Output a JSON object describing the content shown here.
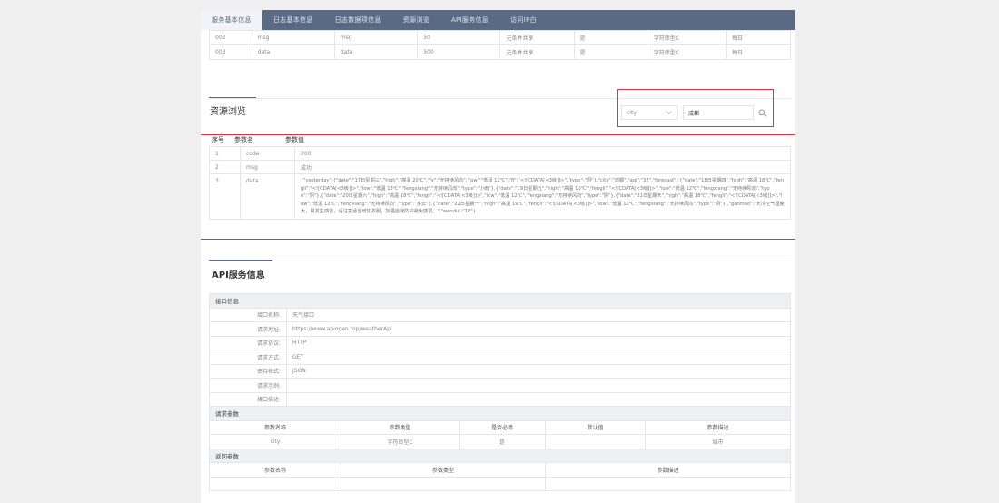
{
  "tabs": [
    "服务基本信息",
    "日志基本信息",
    "日志数据项信息",
    "资源浏览",
    "API服务信息",
    "访问IP白"
  ],
  "top_rows": [
    [
      "002",
      "msg",
      "msg",
      "50",
      "无条件共享",
      "是",
      "字符串型C",
      "每日"
    ],
    [
      "003",
      "data",
      "data",
      "500",
      "无条件共享",
      "是",
      "字符串型C",
      "每日"
    ]
  ],
  "resource": {
    "title": "资源浏览",
    "search_field": "city",
    "search_value": "成都",
    "headers": [
      "序号",
      "参数名",
      "参数值"
    ],
    "rows": [
      {
        "no": "1",
        "name": "code",
        "value": "200"
      },
      {
        "no": "2",
        "name": "msg",
        "value": "成功"
      },
      {
        "no": "3",
        "name": "data",
        "value": "{\"yesterday\":{\"date\":\"17日星期三\",\"high\":\"高温 20℃\",\"fx\":\"无持续风向\",\"low\":\"低温 12℃\",\"fl\":\"<![CDATA[<3级]]>\",\"type\":\"阴\"},\"city\":\"成都\",\"aqi\":\"35\",\"forecast\":[{\"date\":\"18日星期四\",\"high\":\"高温 18℃\",\"fengli\":\"<![CDATA[<3级]]>\",\"low\":\"低温 13℃\",\"fengxiang\":\"无持续风向\",\"type\":\"小雨\"},{\"date\":\"19日星期五\",\"high\":\"高温 16℃\",\"fengli\":\"<![CDATA[<3级]]>\",\"low\":\"低温 12℃\",\"fengxiang\":\"无持续风向\",\"type\":\"阴\"},{\"date\":\"20日星期六\",\"high\":\"高温 18℃\",\"fengli\":\"<![CDATA[<3级]]>\",\"low\":\"低温 12℃\",\"fengxiang\":\"无持续风向\",\"type\":\"阴\"},{\"date\":\"21日星期天\",\"high\":\"高温 18℃\",\"fengli\":\"<![CDATA[<3级]]>\",\"low\":\"低温 12℃\",\"fengxiang\":\"无持续风向\",\"type\":\"多云\"},{\"date\":\"22日星期一\",\"high\":\"高温 19℃\",\"fengli\":\"<![CDATA[<3级]]>\",\"low\":\"低温 12℃\",\"fengxiang\":\"无持续风向\",\"type\":\"阴\"}],\"ganmao\":\"天冷空气湿度大，易发生感冒，请注意适当增加衣服，加强自我防护避免感冒。\",\"wendu\":\"16\"}"
      }
    ]
  },
  "api": {
    "title": "API服务信息",
    "interface_group": "接口信息",
    "fields": [
      {
        "label": "接口名称:",
        "value": "天气接口"
      },
      {
        "label": "请求地址:",
        "value": "https://www.apiopen.top/weatherApi"
      },
      {
        "label": "请求协议:",
        "value": "HTTP"
      },
      {
        "label": "请求方式:",
        "value": "GET"
      },
      {
        "label": "支持格式:",
        "value": "JSON"
      },
      {
        "label": "请求示例:",
        "value": ""
      },
      {
        "label": "接口描述:",
        "value": ""
      }
    ],
    "request_group": "请求参数",
    "request_headers": [
      "参数名称",
      "参数类型",
      "是否必填",
      "默认值",
      "参数描述"
    ],
    "request_rows": [
      [
        "city",
        "字符串型C",
        "是",
        "",
        "城市"
      ]
    ],
    "response_group": "返回参数",
    "response_headers": [
      "参数名称",
      "参数类型",
      "参数描述"
    ]
  },
  "colors": {
    "tab_bar": "#5b6a84",
    "highlight": "#e8303a",
    "group_bg": "#eef0f3"
  }
}
